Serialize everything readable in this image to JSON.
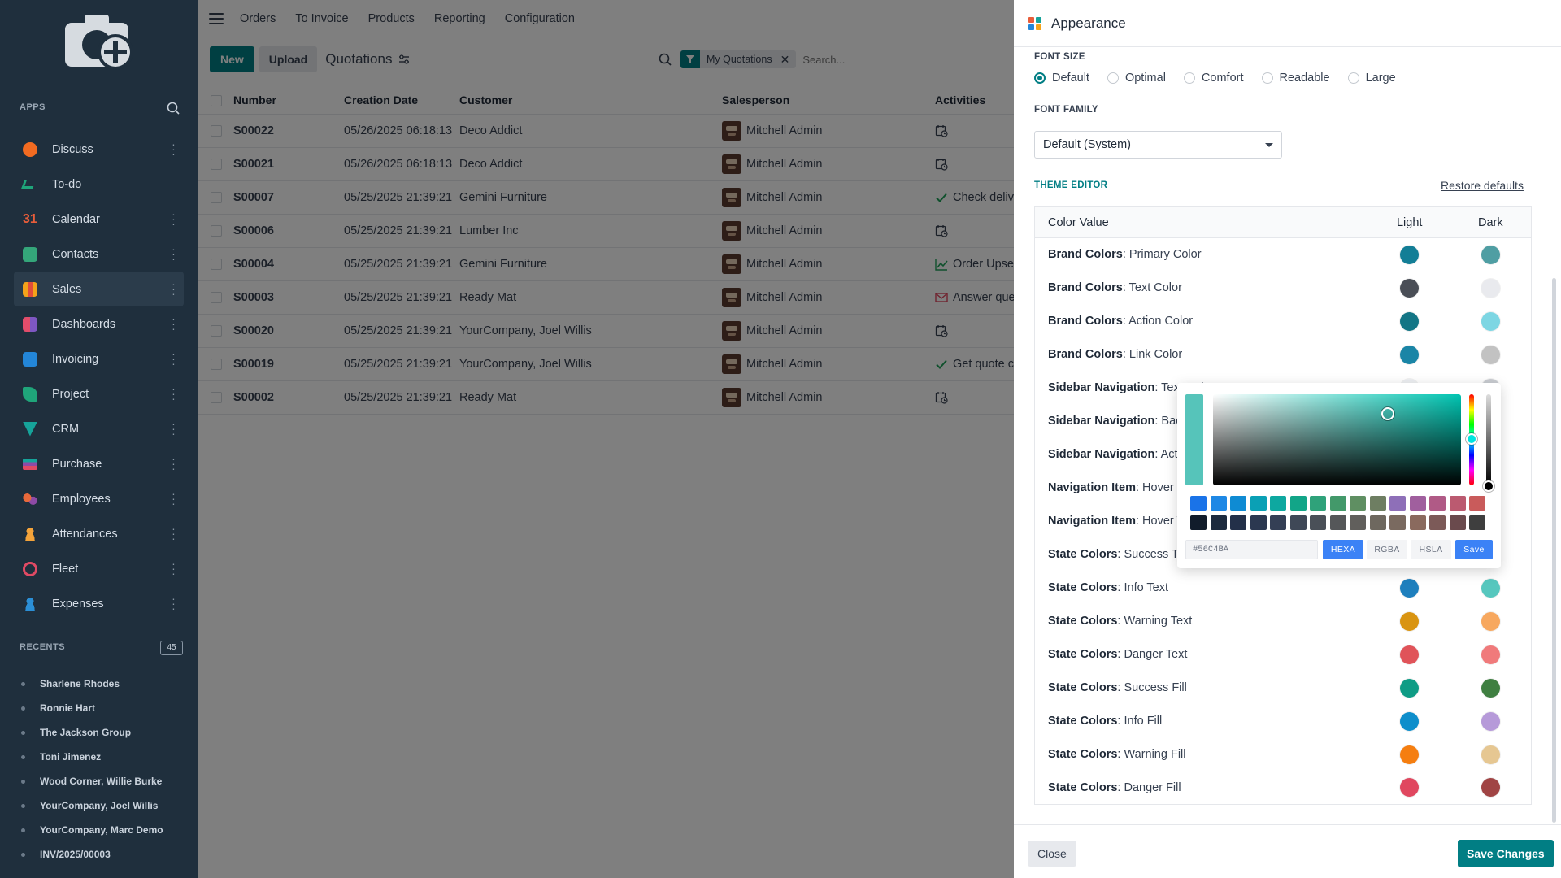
{
  "sidebar": {
    "apps_label": "APPS",
    "apps": [
      {
        "label": "Discuss",
        "color": "#f26b21"
      },
      {
        "label": "To-do",
        "color": "#1fa57a"
      },
      {
        "label": "Calendar",
        "color": "#e85d3a"
      },
      {
        "label": "Contacts",
        "color": "#34a67a"
      },
      {
        "label": "Sales",
        "color": "#f4a31a"
      },
      {
        "label": "Dashboards",
        "color": "#e24d6b"
      },
      {
        "label": "Invoicing",
        "color": "#2386d8"
      },
      {
        "label": "Project",
        "color": "#1fa57a"
      },
      {
        "label": "CRM",
        "color": "#16a39a"
      },
      {
        "label": "Purchase",
        "color": "#8e4aa6"
      },
      {
        "label": "Employees",
        "color": "#e8693b"
      },
      {
        "label": "Attendances",
        "color": "#f3a33a"
      },
      {
        "label": "Fleet",
        "color": "#e04a64"
      },
      {
        "label": "Expenses",
        "color": "#2b8fd6"
      }
    ],
    "recents_label": "RECENTS",
    "recents_count": "45",
    "recents": [
      "Sharlene Rhodes",
      "Ronnie Hart",
      "The Jackson Group",
      "Toni Jimenez",
      "Wood Corner, Willie Burke",
      "YourCompany, Joel Willis",
      "YourCompany, Marc Demo",
      "INV/2025/00003"
    ]
  },
  "topbar": {
    "menus": [
      "Orders",
      "To Invoice",
      "Products",
      "Reporting",
      "Configuration"
    ]
  },
  "controls": {
    "new_label": "New",
    "upload_label": "Upload",
    "view_title": "Quotations",
    "facet_label": "My Quotations",
    "search_placeholder": "Search..."
  },
  "list": {
    "columns": [
      "Number",
      "Creation Date",
      "Customer",
      "Salesperson",
      "Activities"
    ],
    "rows": [
      {
        "number": "S00022",
        "date": "05/26/2025 06:18:13",
        "customer": "Deco Addict",
        "salesperson": "Mitchell Admin",
        "activity": "",
        "activity_icon": "clock-icon"
      },
      {
        "number": "S00021",
        "date": "05/26/2025 06:18:13",
        "customer": "Deco Addict",
        "salesperson": "Mitchell Admin",
        "activity": "",
        "activity_icon": "clock-icon"
      },
      {
        "number": "S00007",
        "date": "05/25/2025 21:39:21",
        "customer": "Gemini Furniture",
        "salesperson": "Mitchell Admin",
        "activity": "Check deliv",
        "activity_icon": "check-icon"
      },
      {
        "number": "S00006",
        "date": "05/25/2025 21:39:21",
        "customer": "Lumber Inc",
        "salesperson": "Mitchell Admin",
        "activity": "",
        "activity_icon": "clock-icon"
      },
      {
        "number": "S00004",
        "date": "05/25/2025 21:39:21",
        "customer": "Gemini Furniture",
        "salesperson": "Mitchell Admin",
        "activity": "Order Upsel",
        "activity_icon": "chart-icon"
      },
      {
        "number": "S00003",
        "date": "05/25/2025 21:39:21",
        "customer": "Ready Mat",
        "salesperson": "Mitchell Admin",
        "activity": "Answer que",
        "activity_icon": "mail-icon"
      },
      {
        "number": "S00020",
        "date": "05/25/2025 21:39:21",
        "customer": "YourCompany, Joel Willis",
        "salesperson": "Mitchell Admin",
        "activity": "",
        "activity_icon": "clock-icon"
      },
      {
        "number": "S00019",
        "date": "05/25/2025 21:39:21",
        "customer": "YourCompany, Joel Willis",
        "salesperson": "Mitchell Admin",
        "activity": "Get quote c",
        "activity_icon": "check-icon"
      },
      {
        "number": "S00002",
        "date": "05/25/2025 21:39:21",
        "customer": "Ready Mat",
        "salesperson": "Mitchell Admin",
        "activity": "",
        "activity_icon": "clock-icon"
      }
    ]
  },
  "dialog": {
    "title": "Appearance",
    "font_size_label": "FONT SIZE",
    "font_sizes": [
      "Default",
      "Optimal",
      "Comfort",
      "Readable",
      "Large"
    ],
    "font_size_selected": "Default",
    "font_family_label": "FONT FAMILY",
    "font_family_value": "Default (System)",
    "theme_editor_label": "THEME EDITOR",
    "restore_label": "Restore defaults",
    "table_headers": [
      "Color Value",
      "Light",
      "Dark"
    ],
    "colors": [
      {
        "group": "Brand Colors",
        "name": "Primary Color",
        "light": "#137e96",
        "dark": "#4f9ea3"
      },
      {
        "group": "Brand Colors",
        "name": "Text Color",
        "light": "#4a4e56",
        "dark": "#e9eaee"
      },
      {
        "group": "Brand Colors",
        "name": "Action Color",
        "light": "#137585",
        "dark": "#7dd6e3"
      },
      {
        "group": "Brand Colors",
        "name": "Link Color",
        "light": "#1a85a6",
        "dark": "#c2c2c2"
      },
      {
        "group": "Sidebar Navigation",
        "name": "Text Color",
        "light": "#eef0f3",
        "dark": "#c9ccd1"
      },
      {
        "group": "Sidebar Navigation",
        "name": "Background Color",
        "light": "#1f2f3d",
        "dark": "#151b22"
      },
      {
        "group": "Sidebar Navigation",
        "name": "Active Color",
        "light": "#2b3c4b",
        "dark": "#1e2833"
      },
      {
        "group": "Navigation Item",
        "name": "Hover Fill",
        "light": "#e5e7eb",
        "dark": "#374151"
      },
      {
        "group": "Navigation Item",
        "name": "Hover Text",
        "light": "#1f2937",
        "dark": "#e5e7eb"
      },
      {
        "group": "State Colors",
        "name": "Success Text",
        "light": "#1a8f5d",
        "dark": "#56C4BA"
      },
      {
        "group": "State Colors",
        "name": "Info Text",
        "light": "#1e7fbd",
        "dark": "#56c7be"
      },
      {
        "group": "State Colors",
        "name": "Warning Text",
        "light": "#d99411",
        "dark": "#f7a85f"
      },
      {
        "group": "State Colors",
        "name": "Danger Text",
        "light": "#e05359",
        "dark": "#f07a7b"
      },
      {
        "group": "State Colors",
        "name": "Success Fill",
        "light": "#0f9c85",
        "dark": "#3f7f41"
      },
      {
        "group": "State Colors",
        "name": "Info Fill",
        "light": "#0e8ecb",
        "dark": "#b69ad9"
      },
      {
        "group": "State Colors",
        "name": "Warning Fill",
        "light": "#f57e10",
        "dark": "#e6c792"
      },
      {
        "group": "State Colors",
        "name": "Danger Fill",
        "light": "#e0475f",
        "dark": "#a04444"
      }
    ],
    "close_label": "Close",
    "save_label": "Save Changes"
  },
  "picker": {
    "hex_value": "#56C4BA",
    "modes": [
      "HEXA",
      "RGBA",
      "HSLA"
    ],
    "active_mode": "HEXA",
    "save_label": "Save",
    "swatches_row1": [
      "#1a73e8",
      "#1e88e5",
      "#0f8bd3",
      "#0aa0b5",
      "#0ea8a0",
      "#12a588",
      "#2fa27a",
      "#43996a",
      "#5f8f62",
      "#6e7e62",
      "#8e6fb8",
      "#a05f9e",
      "#b05a86",
      "#bb5a70",
      "#c95b5b"
    ],
    "swatches_row2": [
      "#111c2b",
      "#1c2a3e",
      "#233049",
      "#2b3850",
      "#343f55",
      "#3f4857",
      "#4a5058",
      "#555759",
      "#615f5c",
      "#6e685f",
      "#7a6a60",
      "#8a6a5e",
      "#7c5a58",
      "#6a4a4d",
      "#3e3e3e"
    ]
  }
}
